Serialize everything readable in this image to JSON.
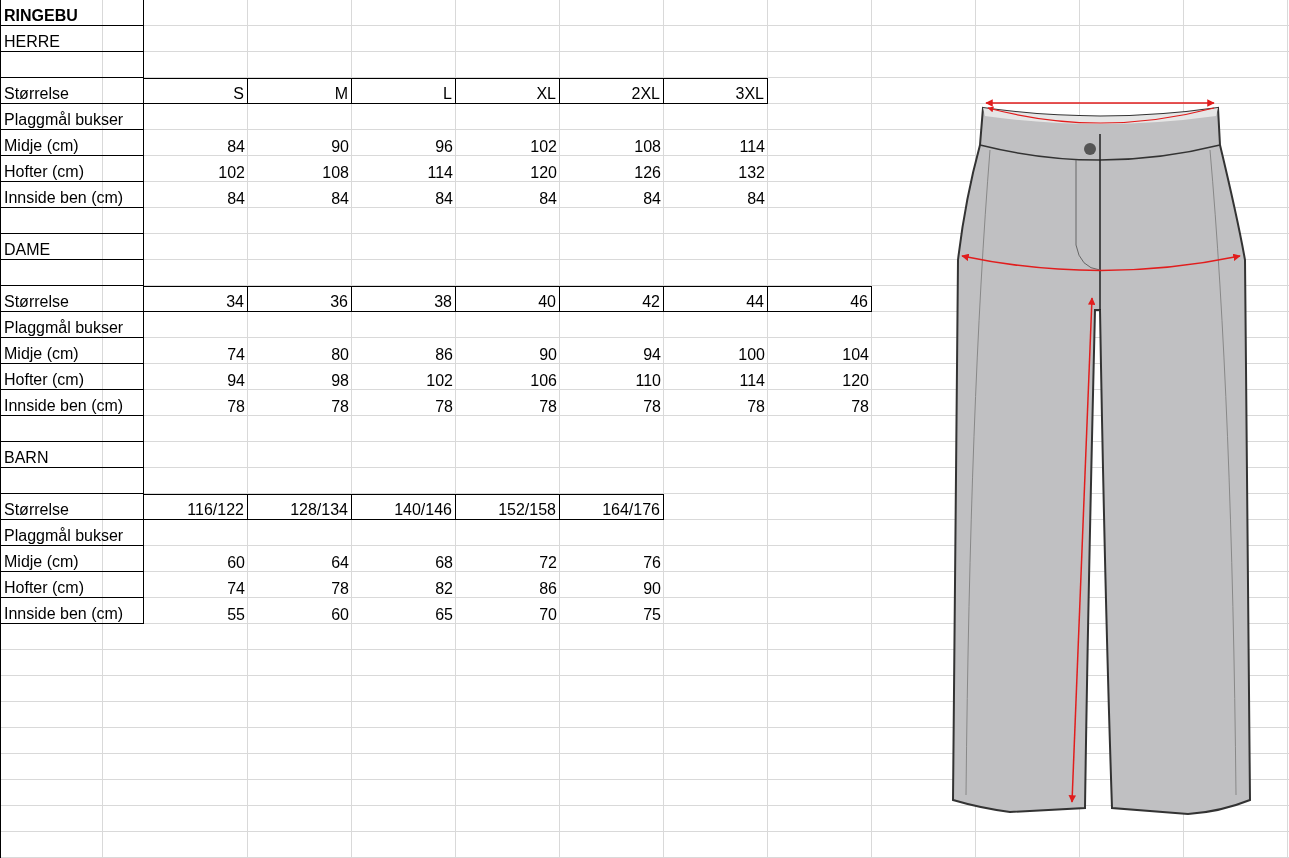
{
  "title": "RINGEBU",
  "sections": [
    {
      "heading": "HERRE",
      "size_label": "Størrelse",
      "sizes": [
        "S",
        "M",
        "L",
        "XL",
        "2XL",
        "3XL"
      ],
      "subheading": "Plaggmål bukser",
      "rows": [
        {
          "label": "Midje (cm)",
          "values": [
            "84",
            "90",
            "96",
            "102",
            "108",
            "114"
          ]
        },
        {
          "label": "Hofter (cm)",
          "values": [
            "102",
            "108",
            "114",
            "120",
            "126",
            "132"
          ]
        },
        {
          "label": "Innside ben (cm)",
          "values": [
            "84",
            "84",
            "84",
            "84",
            "84",
            "84"
          ]
        }
      ]
    },
    {
      "heading": "DAME",
      "size_label": "Størrelse",
      "sizes": [
        "34",
        "36",
        "38",
        "40",
        "42",
        "44",
        "46"
      ],
      "subheading": "Plaggmål bukser",
      "rows": [
        {
          "label": "Midje (cm)",
          "values": [
            "74",
            "80",
            "86",
            "90",
            "94",
            "100",
            "104"
          ]
        },
        {
          "label": "Hofter (cm)",
          "values": [
            "94",
            "98",
            "102",
            "106",
            "110",
            "114",
            "120"
          ]
        },
        {
          "label": "Innside ben (cm)",
          "values": [
            "78",
            "78",
            "78",
            "78",
            "78",
            "78",
            "78"
          ]
        }
      ]
    },
    {
      "heading": "BARN",
      "size_label": "Størrelse",
      "sizes": [
        "116/122",
        "128/134",
        "140/146",
        "152/158",
        "164/176"
      ],
      "subheading": "Plaggmål bukser",
      "rows": [
        {
          "label": "Midje (cm)",
          "values": [
            "60",
            "64",
            "68",
            "72",
            "76"
          ]
        },
        {
          "label": "Hofter (cm)",
          "values": [
            "74",
            "78",
            "82",
            "86",
            "90"
          ]
        },
        {
          "label": "Innside ben (cm)",
          "values": [
            "55",
            "60",
            "65",
            "70",
            "75"
          ]
        }
      ]
    }
  ]
}
